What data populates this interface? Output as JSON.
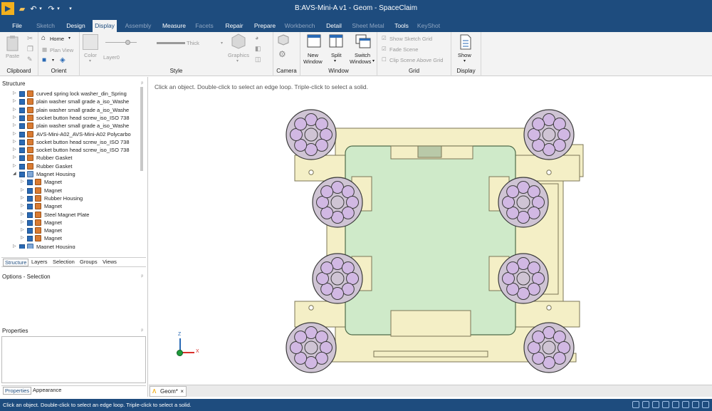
{
  "app_title": "B:AVS-Mini-A v1 - Geom - SpaceClaim",
  "quick_access": {
    "logo_icon": "spaceclaim-logo-icon",
    "open_icon": "folder-icon",
    "undo_icon": "undo-icon",
    "redo_icon": "redo-icon",
    "customize_icon": "customize-icon"
  },
  "tabs": [
    "File",
    "Sketch",
    "Design",
    "Display",
    "Assembly",
    "Measure",
    "Facets",
    "Repair",
    "Prepare",
    "Workbench",
    "Detail",
    "Sheet Metal",
    "Tools",
    "KeyShot"
  ],
  "active_tab": "Display",
  "ribbon": {
    "clipboard": {
      "label": "Clipboard",
      "paste": "Paste"
    },
    "orient": {
      "label": "Orient",
      "home": "Home",
      "plan_view": "Plan View"
    },
    "style": {
      "label": "Style",
      "color": "Color",
      "layer": "Layer0",
      "thick": "Thick",
      "graphics": "Graphics"
    },
    "camera": {
      "label": "Camera"
    },
    "window": {
      "label": "Window",
      "new_window": "New",
      "new_window2": "Window",
      "split": "Split",
      "switch_windows": "Switch",
      "switch_windows2": "Windows"
    },
    "grid": {
      "label": "Grid",
      "show_sketch_grid": "Show Sketch Grid",
      "fade_scene": "Fade Scene",
      "clip_scene": "Clip Scene Above Grid"
    },
    "display": {
      "label": "Display",
      "show": "Show"
    }
  },
  "structure": {
    "title": "Structure",
    "rows": [
      {
        "label": "curved spring lock washer_din_Spring",
        "indent": 0,
        "type": "comp"
      },
      {
        "label": "plain washer small grade a_iso_Washe",
        "indent": 0,
        "type": "comp"
      },
      {
        "label": "plain washer small grade a_iso_Washe",
        "indent": 0,
        "type": "comp"
      },
      {
        "label": "socket button head screw_iso_ISO 738",
        "indent": 0,
        "type": "comp"
      },
      {
        "label": "plain washer small grade a_iso_Washe",
        "indent": 0,
        "type": "comp"
      },
      {
        "label": "AVS-Mini-A02_AVS-Mini-A02 Polycarbo",
        "indent": 0,
        "type": "comp"
      },
      {
        "label": "socket button head screw_iso_ISO 738",
        "indent": 0,
        "type": "comp"
      },
      {
        "label": "socket button head screw_iso_ISO 738",
        "indent": 0,
        "type": "comp"
      },
      {
        "label": "Rubber Gasket",
        "indent": 0,
        "type": "comp"
      },
      {
        "label": "Rubber Gasket",
        "indent": 0,
        "type": "comp"
      },
      {
        "label": "Magnet Housing",
        "indent": 0,
        "type": "asm",
        "expanded": true
      },
      {
        "label": "Magnet",
        "indent": 1,
        "type": "comp"
      },
      {
        "label": "Magnet",
        "indent": 1,
        "type": "comp"
      },
      {
        "label": "Rubber Housing",
        "indent": 1,
        "type": "comp"
      },
      {
        "label": "Magnet",
        "indent": 1,
        "type": "comp"
      },
      {
        "label": "Steel Magnet Plate",
        "indent": 1,
        "type": "comp"
      },
      {
        "label": "Magnet",
        "indent": 1,
        "type": "comp"
      },
      {
        "label": "Magnet",
        "indent": 1,
        "type": "comp"
      },
      {
        "label": "Magnet",
        "indent": 1,
        "type": "comp"
      },
      {
        "label": "Magnet Housing",
        "indent": 0,
        "type": "asm"
      }
    ]
  },
  "panel_tabs": [
    "Structure",
    "Layers",
    "Selection",
    "Groups",
    "Views"
  ],
  "active_panel_tab": "Structure",
  "options_title": "Options - Selection",
  "properties_title": "Properties",
  "bottom_tabs": [
    "Properties",
    "Appearance"
  ],
  "viewport": {
    "hint": "Click an object. Double-click to select an edge loop. Triple-click to select a solid.",
    "axis_z": "Z",
    "axis_x": "X"
  },
  "doc_tab": {
    "label": "Geom*",
    "close": "×"
  },
  "status_text": "Click an object. Double-click to select an edge loop. Triple-click to select a solid.",
  "colors": {
    "titlebar": "#1e4c7e",
    "plate": "#f4efc6",
    "plate_edge": "#7b7656",
    "window": "#cfeac9",
    "magnet_outer": "#cfc4d4",
    "magnet_inner": "#d1b8e3",
    "edge": "#3b3b3b"
  }
}
